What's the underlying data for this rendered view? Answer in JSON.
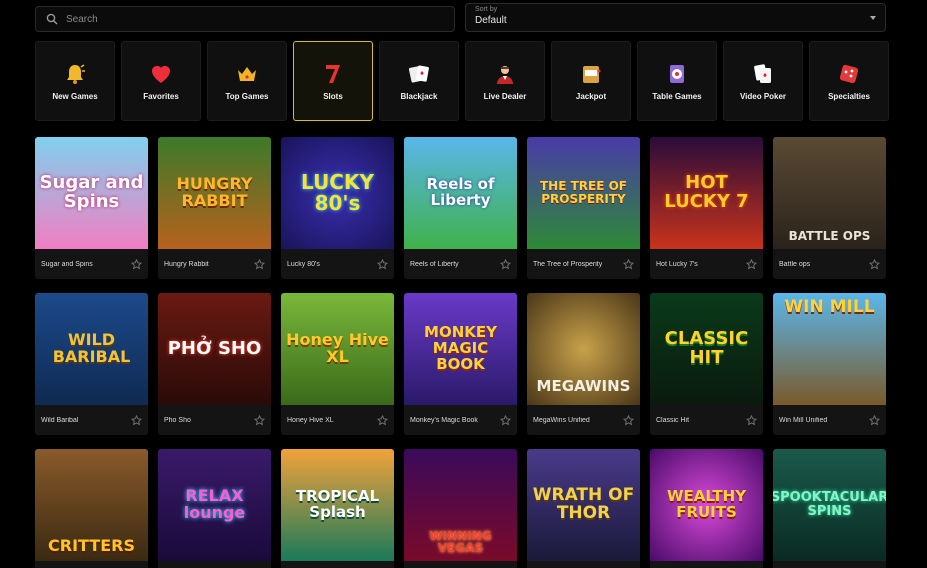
{
  "search": {
    "placeholder": "Search",
    "value": ""
  },
  "sort": {
    "label": "Sort by",
    "value": "Default"
  },
  "categories": [
    {
      "label": "New Games",
      "icon": "bell-icon",
      "active": false
    },
    {
      "label": "Favorites",
      "icon": "heart-icon",
      "active": false
    },
    {
      "label": "Top Games",
      "icon": "crown-icon",
      "active": false
    },
    {
      "label": "Slots",
      "icon": "seven-icon",
      "active": true
    },
    {
      "label": "Blackjack",
      "icon": "cards-icon",
      "active": false
    },
    {
      "label": "Live Dealer",
      "icon": "dealer-icon",
      "active": false
    },
    {
      "label": "Jackpot",
      "icon": "jackpot-icon",
      "active": false
    },
    {
      "label": "Table Games",
      "icon": "roulette-icon",
      "active": false
    },
    {
      "label": "Video Poker",
      "icon": "poker-icon",
      "active": false
    },
    {
      "label": "Specialties",
      "icon": "dice-icon",
      "active": false
    }
  ],
  "games": [
    {
      "name": "Sugar and Spins",
      "art": "Sugar and Spins"
    },
    {
      "name": "Hungry Rabbit",
      "art": "HUNGRY RABBIT"
    },
    {
      "name": "Lucky 80's",
      "art": "LUCKY 80's"
    },
    {
      "name": "Reels of Liberty",
      "art": "Reels of Liberty"
    },
    {
      "name": "The Tree of Prosperity",
      "art": "THE TREE OF PROSPERITY"
    },
    {
      "name": "Hot Lucky 7's",
      "art": "HOT LUCKY 7"
    },
    {
      "name": "Battle ops",
      "art": "BATTLE OPS"
    },
    {
      "name": "Wild Baribal",
      "art": "WILD BARIBAL"
    },
    {
      "name": "Pho Sho",
      "art": "PHỞ SHO"
    },
    {
      "name": "Honey Hive XL",
      "art": "Honey Hive XL"
    },
    {
      "name": "Monkey's Magic Book",
      "art": "MONKEY MAGIC BOOK"
    },
    {
      "name": "MegaWins Unified",
      "art": "MEGAWINS"
    },
    {
      "name": "Classic Hit",
      "art": "CLASSIC HIT"
    },
    {
      "name": "Win Mill Unified",
      "art": "WIN MILL"
    },
    {
      "name": "",
      "art": "CRITTERS"
    },
    {
      "name": "",
      "art": "RELAX lounge"
    },
    {
      "name": "",
      "art": "TROPICAL Splash"
    },
    {
      "name": "",
      "art": "WINNING VEGAS"
    },
    {
      "name": "",
      "art": "WRATH OF THOR"
    },
    {
      "name": "",
      "art": "WEALTHY FRUITS"
    },
    {
      "name": "",
      "art": "SPOOKTACULAR SPINS"
    }
  ],
  "colors": {
    "accent": "#d7c21c",
    "background": "#000000",
    "card": "#141414"
  }
}
